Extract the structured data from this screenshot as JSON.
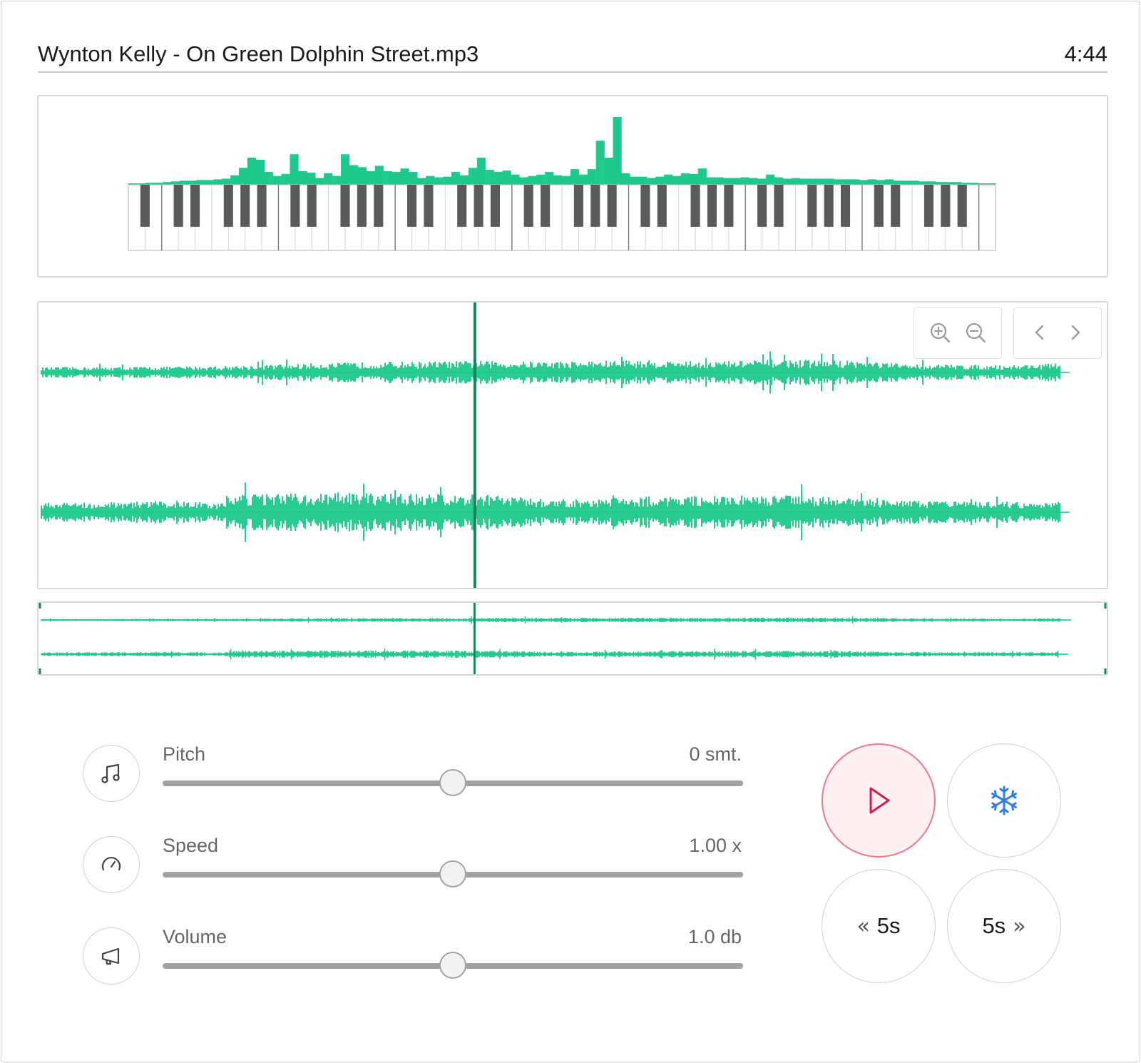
{
  "header": {
    "file_title": "Wynton Kelly - On Green Dolphin Street.mp3",
    "duration": "4:44"
  },
  "colors": {
    "accent_green": "#1dc98b",
    "playhead": "#14855c",
    "play_border": "#f0768b",
    "play_bg": "#fff0f2",
    "play_icon": "#d01c4b",
    "freeze_icon": "#2f7fe8",
    "slider_track": "#a3a3a3"
  },
  "piano": {
    "white_keys": 52,
    "spectrum_levels": [
      0.02,
      0.02,
      0.03,
      0.03,
      0.04,
      0.05,
      0.06,
      0.06,
      0.07,
      0.07,
      0.08,
      0.09,
      0.14,
      0.25,
      0.4,
      0.37,
      0.19,
      0.13,
      0.16,
      0.45,
      0.2,
      0.18,
      0.1,
      0.17,
      0.13,
      0.45,
      0.29,
      0.26,
      0.2,
      0.28,
      0.2,
      0.19,
      0.24,
      0.19,
      0.1,
      0.13,
      0.11,
      0.12,
      0.19,
      0.14,
      0.25,
      0.4,
      0.22,
      0.19,
      0.21,
      0.15,
      0.11,
      0.13,
      0.15,
      0.19,
      0.14,
      0.13,
      0.23,
      0.15,
      0.23,
      0.65,
      0.4,
      1.0,
      0.17,
      0.12,
      0.12,
      0.1,
      0.12,
      0.15,
      0.13,
      0.17,
      0.16,
      0.24,
      0.11,
      0.11,
      0.1,
      0.1,
      0.11,
      0.1,
      0.09,
      0.15,
      0.11,
      0.09,
      0.1,
      0.09,
      0.09,
      0.09,
      0.09,
      0.08,
      0.08,
      0.08,
      0.07,
      0.08,
      0.07,
      0.08,
      0.06,
      0.06,
      0.06,
      0.05,
      0.05,
      0.04,
      0.04,
      0.04,
      0.03,
      0.03,
      0.02,
      0.02
    ]
  },
  "waveform": {
    "zoom_in": "zoom-in-icon",
    "zoom_out": "zoom-out-icon",
    "prev": "chevron-left-icon",
    "next": "chevron-right-icon",
    "playhead_fraction": 0.425
  },
  "controls": {
    "pitch": {
      "label": "Pitch",
      "value": "0 smt.",
      "position": 0.5,
      "icon": "music-note-icon"
    },
    "speed": {
      "label": "Speed",
      "value": "1.00 x",
      "position": 0.5,
      "icon": "speedometer-icon"
    },
    "volume": {
      "label": "Volume",
      "value": "1.0 db",
      "position": 0.5,
      "icon": "megaphone-icon"
    }
  },
  "transport": {
    "play_icon": "play-icon",
    "freeze_icon": "snowflake-icon",
    "back_label": "5s",
    "forward_label": "5s",
    "back_icon": "double-chevron-left-icon",
    "forward_icon": "double-chevron-right-icon"
  }
}
